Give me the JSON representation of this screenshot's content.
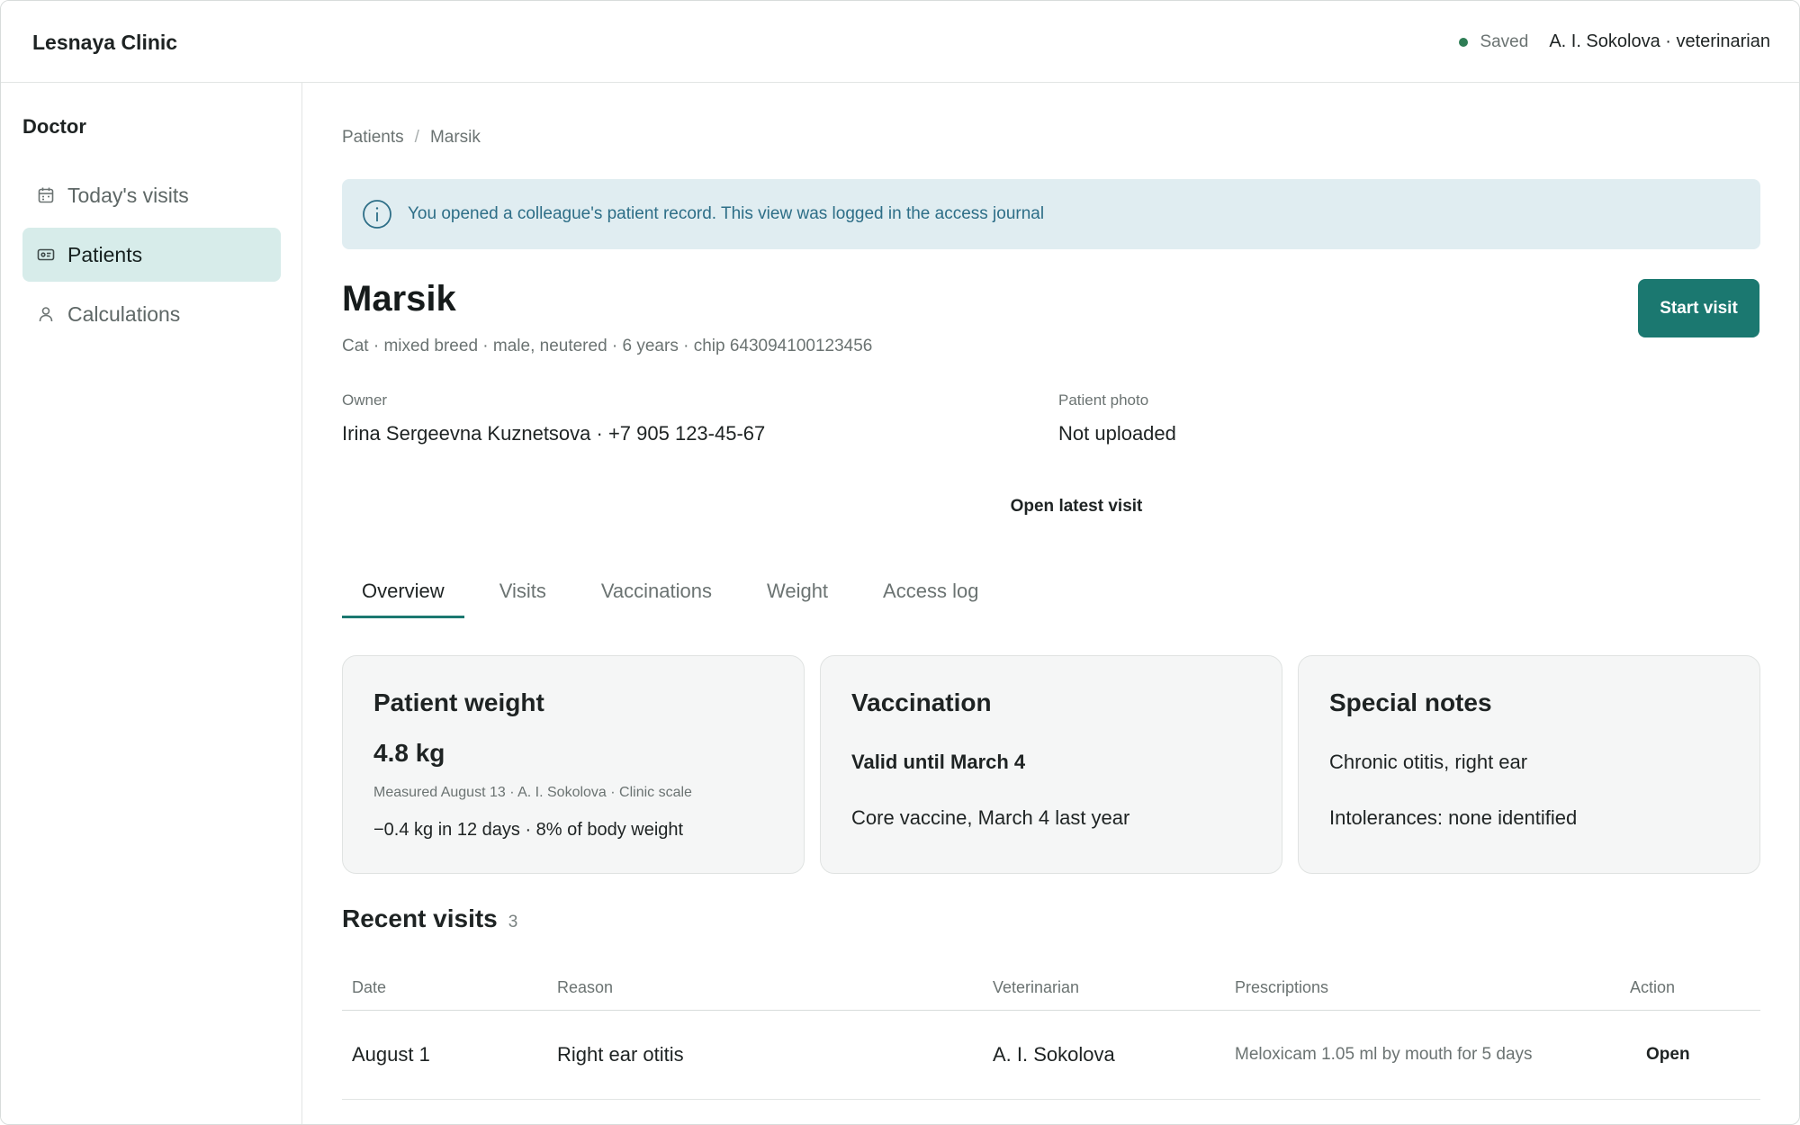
{
  "app": {
    "brand": "Lesnaya Clinic",
    "status": "Saved",
    "user": "A. I. Sokolova · veterinarian",
    "status_color": "#2e7d55",
    "accent_color": "#1b7870"
  },
  "sidebar": {
    "title": "Doctor",
    "items": [
      {
        "label": "Today's visits",
        "icon": "calendar-icon",
        "active": false
      },
      {
        "label": "Patients",
        "icon": "id-card-icon",
        "active": true
      },
      {
        "label": "Calculations",
        "icon": "person-icon",
        "active": false
      }
    ]
  },
  "breadcrumb": {
    "root": "Patients",
    "separator": "/",
    "current": "Marsik"
  },
  "banner": {
    "icon": "info-icon",
    "text": "You opened a colleague's patient record. This view was logged in the access journal"
  },
  "patient": {
    "name": "Marsik",
    "meta": "Cat · mixed breed · male, neutered · 6 years · chip 643094100123456",
    "start_visit_label": "Start visit",
    "owner_label": "Owner",
    "owner_value": "Irina Sergeevna Kuznetsova · +7 905 123-45-67",
    "photo_label": "Patient photo",
    "photo_value": "Not uploaded",
    "open_latest_label": "Open latest visit"
  },
  "tabs": [
    {
      "label": "Overview",
      "active": true
    },
    {
      "label": "Visits",
      "active": false
    },
    {
      "label": "Vaccinations",
      "active": false
    },
    {
      "label": "Weight",
      "active": false
    },
    {
      "label": "Access log",
      "active": false
    }
  ],
  "cards": {
    "weight": {
      "title": "Patient weight",
      "value": "4.8 kg",
      "measured": "Measured August 13 · A. I. Sokolova · Clinic scale",
      "trend": "−0.4 kg in 12 days · 8% of body weight"
    },
    "vaccination": {
      "title": "Vaccination",
      "status": "Valid until March 4",
      "detail": "Core vaccine, March 4 last year"
    },
    "notes": {
      "title": "Special notes",
      "line1": "Chronic otitis, right ear",
      "line2": "Intolerances: none identified"
    }
  },
  "recent_visits": {
    "title": "Recent visits",
    "count": "3",
    "columns": [
      "Date",
      "Reason",
      "Veterinarian",
      "Prescriptions",
      "Action"
    ],
    "rows": [
      {
        "date": "August 1",
        "reason": "Right ear otitis",
        "vet": "A. I. Sokolova",
        "prescriptions": "Meloxicam 1.05 ml by mouth for 5 days",
        "action": "Open"
      }
    ]
  }
}
